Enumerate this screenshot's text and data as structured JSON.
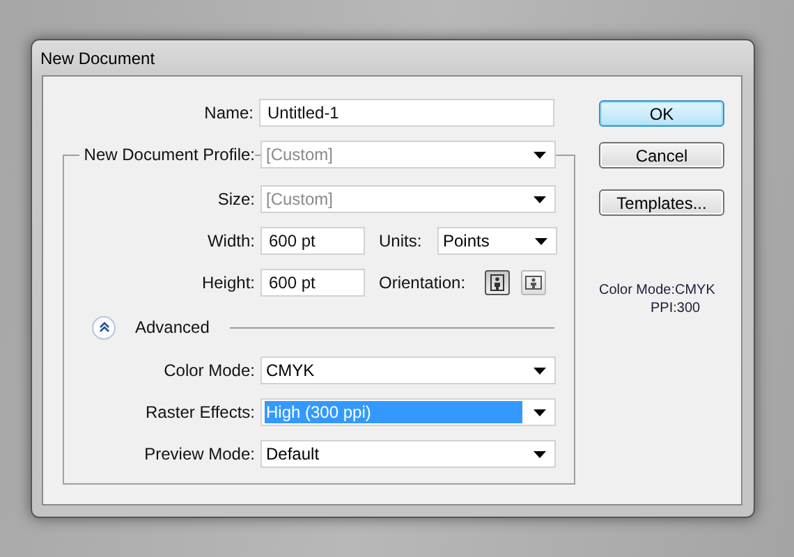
{
  "window": {
    "title": "New Document"
  },
  "name": {
    "label": "Name:",
    "value": "Untitled-1"
  },
  "profile": {
    "label": "New Document Profile:",
    "value": "[Custom]",
    "disabled": true
  },
  "size": {
    "label": "Size:",
    "value": "[Custom]",
    "disabled": true
  },
  "width": {
    "label": "Width:",
    "value": "600 pt"
  },
  "units": {
    "label": "Units:",
    "value": "Points",
    "disabled": false
  },
  "height": {
    "label": "Height:",
    "value": "600 pt"
  },
  "orientation": {
    "label": "Orientation:",
    "options": [
      {
        "kind": "portrait",
        "selected": true
      },
      {
        "kind": "landscape",
        "selected": false
      }
    ]
  },
  "advanced": {
    "label": "Advanced",
    "expanded": true
  },
  "advanced_fields": [
    {
      "label": "Color Mode:",
      "value": "CMYK",
      "highlighted": false
    },
    {
      "label": "Raster Effects:",
      "value": "High (300 ppi)",
      "highlighted": true
    },
    {
      "label": "Preview Mode:",
      "value": "Default",
      "highlighted": false
    }
  ],
  "buttons": [
    {
      "label": "OK",
      "default": true
    },
    {
      "label": "Cancel",
      "default": false
    },
    {
      "label": "Templates...",
      "default": false
    }
  ],
  "summary": [
    "Color Mode:CMYK",
    "PPI:300"
  ]
}
